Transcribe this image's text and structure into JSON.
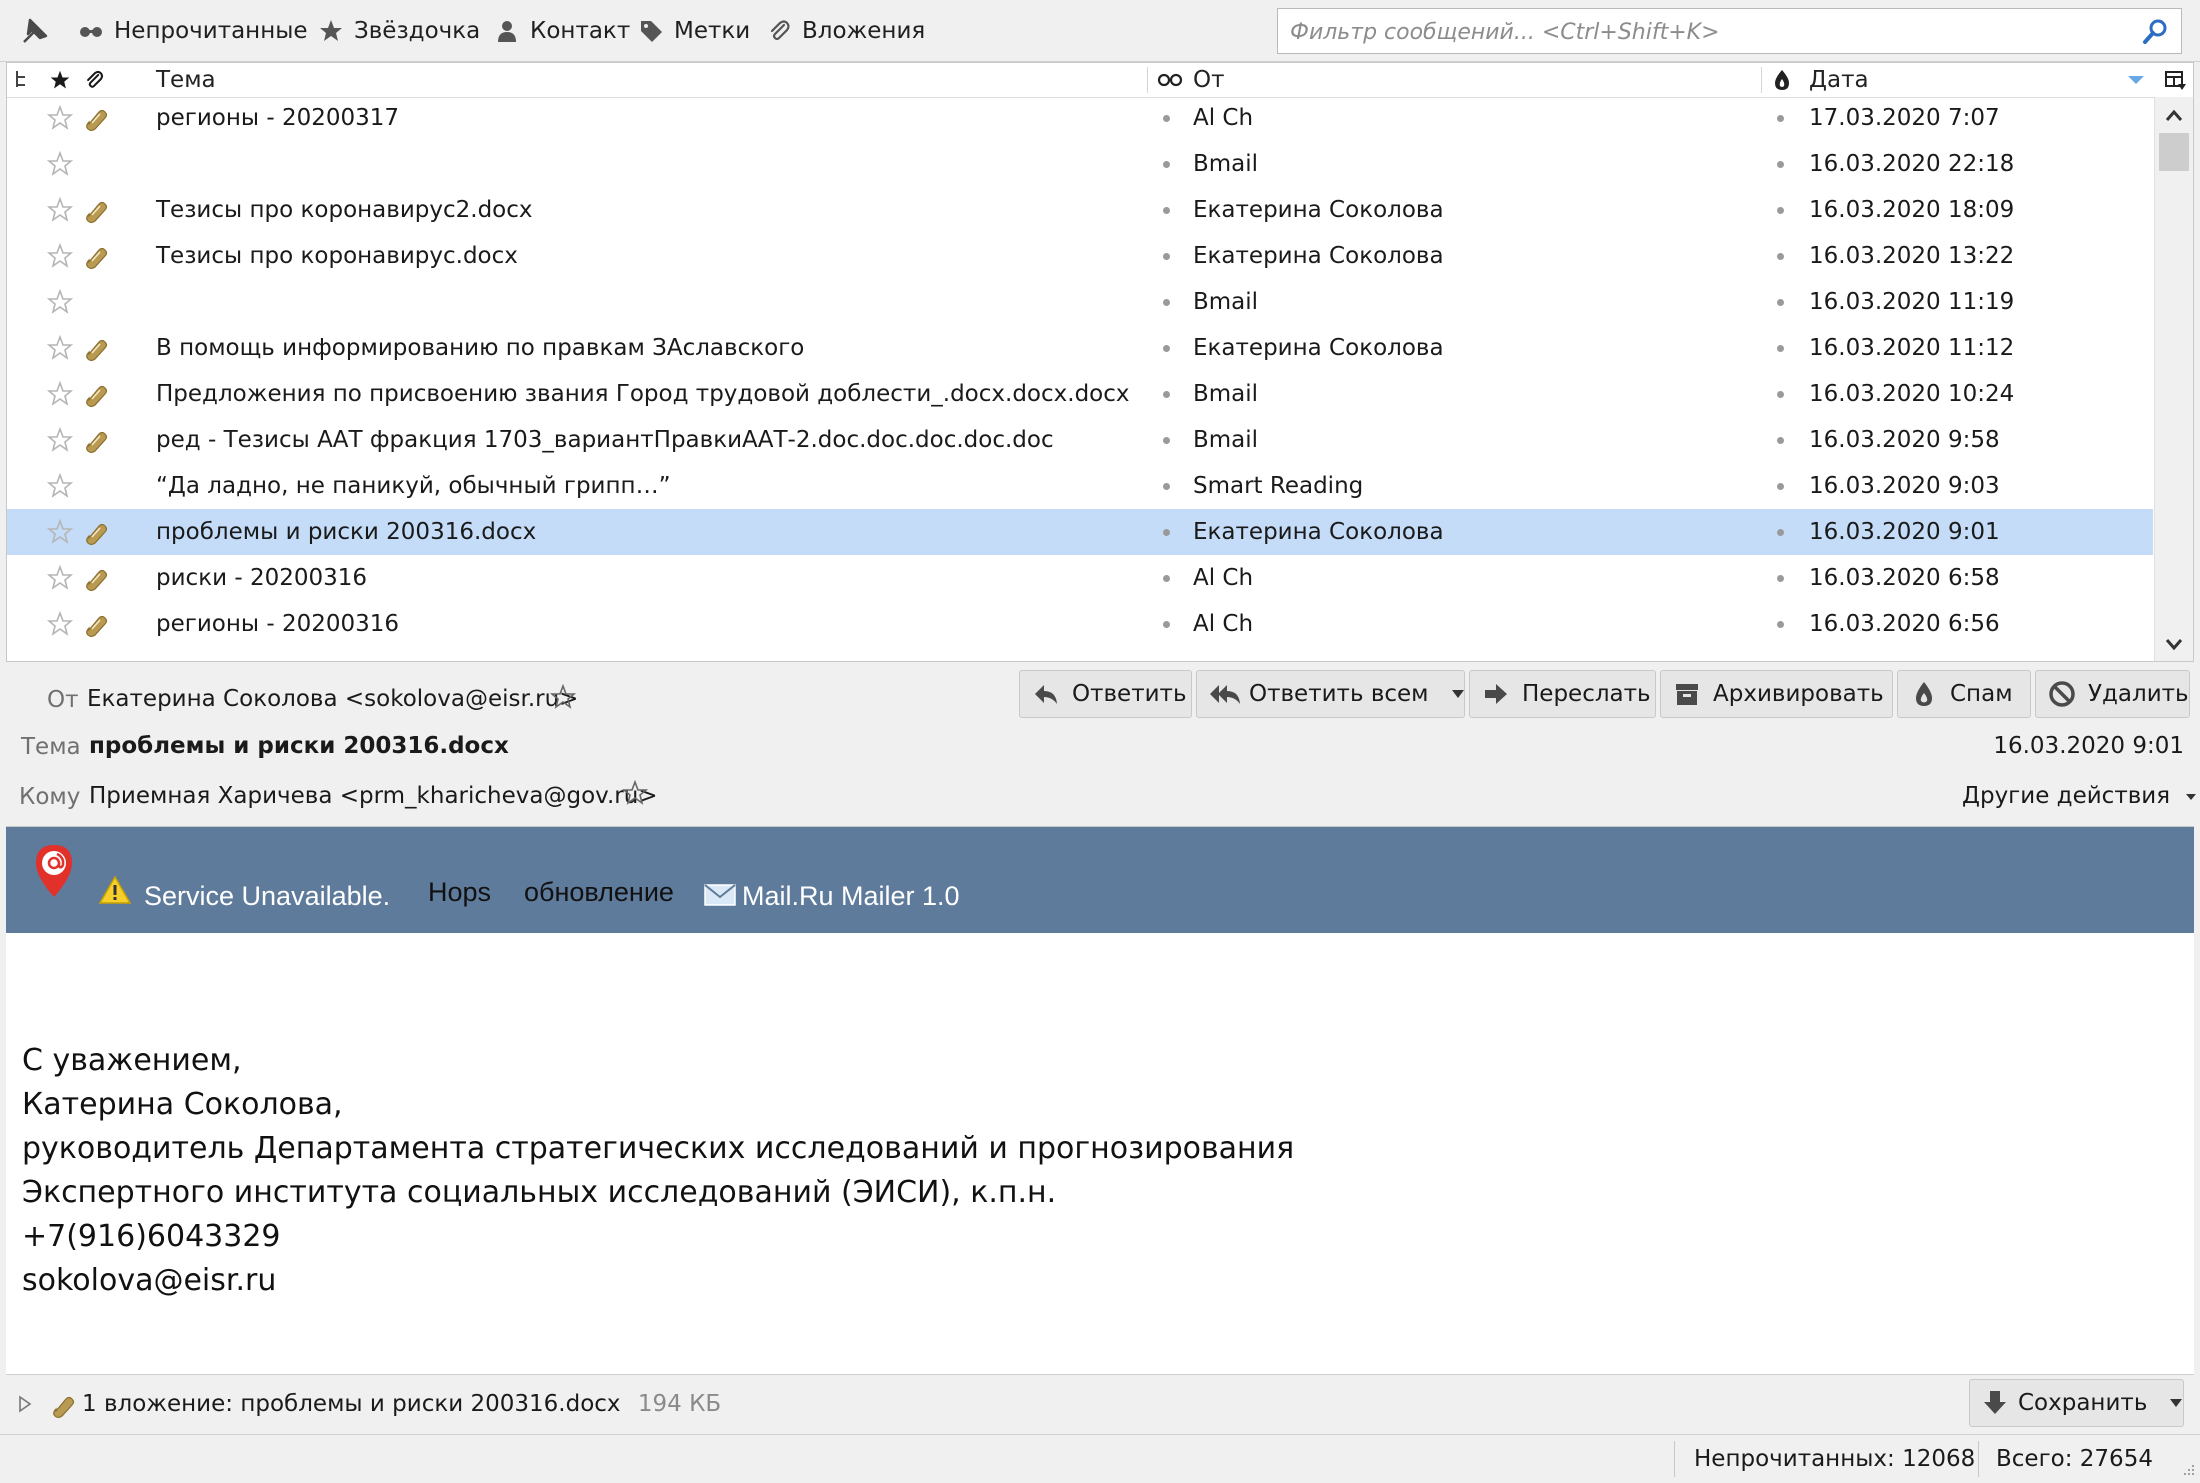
{
  "quick_filter": {
    "unread": "Непрочитанные",
    "starred": "Звёздочка",
    "contact": "Контакт",
    "tags": "Метки",
    "attachments": "Вложения",
    "search_placeholder": "Фильтр сообщений... <Ctrl+Shift+K>"
  },
  "columns": {
    "subject": "Тема",
    "from": "От",
    "date": "Дата"
  },
  "messages": [
    {
      "subject": "регионы - 20200317",
      "from": "Al Ch",
      "date": "17.03.2020 7:07",
      "attachment": true
    },
    {
      "subject": "",
      "from": "Bmail",
      "date": "16.03.2020 22:18",
      "attachment": false
    },
    {
      "subject": "Тезисы про коронавирус2.docx",
      "from": "Екатерина Соколова",
      "date": "16.03.2020 18:09",
      "attachment": true
    },
    {
      "subject": "Тезисы про коронавирус.docx",
      "from": "Екатерина Соколова",
      "date": "16.03.2020 13:22",
      "attachment": true
    },
    {
      "subject": "",
      "from": "Bmail",
      "date": "16.03.2020 11:19",
      "attachment": false
    },
    {
      "subject": "В помощь информированию по правкам ЗАславского",
      "from": "Екатерина Соколова",
      "date": "16.03.2020 11:12",
      "attachment": true
    },
    {
      "subject": "Предложения по присвоению звания Город трудовой доблести_.docx.docx.docx",
      "from": "Bmail",
      "date": "16.03.2020 10:24",
      "attachment": true
    },
    {
      "subject": "ред - Тезисы ААТ фракция 1703_вариантПравкиААТ-2.doc.doc.doc.doc.doc",
      "from": "Bmail",
      "date": "16.03.2020 9:58",
      "attachment": true
    },
    {
      "subject": "“Да ладно, не паникуй, обычный грипп…”",
      "from": "Smart Reading",
      "date": "16.03.2020 9:03",
      "attachment": false
    },
    {
      "subject": "проблемы и риски 200316.docx",
      "from": "Екатерина Соколова",
      "date": "16.03.2020 9:01",
      "attachment": true,
      "selected": true
    },
    {
      "subject": "риски - 20200316",
      "from": "Al Ch",
      "date": "16.03.2020 6:58",
      "attachment": true
    },
    {
      "subject": "регионы - 20200316",
      "from": "Al Ch",
      "date": "16.03.2020 6:56",
      "attachment": true
    }
  ],
  "message_header": {
    "from_label": "От",
    "from_value": "Екатерина Соколова <sokolova@eisr.ru>",
    "subject_label": "Тема",
    "subject_value": "проблемы и риски 200316.docx",
    "date": "16.03.2020 9:01",
    "to_label": "Кому",
    "to_value": "Приемная Харичева <prm_kharicheva@gov.ru>",
    "other_actions": "Другие действия"
  },
  "toolbar": {
    "reply": "Ответить",
    "reply_all": "Ответить всем",
    "forward": "Переслать",
    "archive": "Архивировать",
    "spam": "Спам",
    "delete": "Удалить"
  },
  "banner": {
    "service_unavailable": "Service Unavailable.",
    "hops": "Hops",
    "update": "обновление",
    "mailer": "Mail.Ru Mailer 1.0",
    "background": "#5f7b9c"
  },
  "signature": {
    "line1": "С уважением,",
    "line2": "Катерина Соколова,",
    "line3": "руководитель Департамента стратегических исследований и прогнозирования",
    "line4": "Экспертного института социальных исследований (ЭИСИ), к.п.н.",
    "line5": "+7(916)6043329",
    "line6": "sokolova@eisr.ru"
  },
  "attachment_bar": {
    "text": "1 вложение: проблемы и риски 200316.docx",
    "size": "194 КБ",
    "save": "Сохранить"
  },
  "status": {
    "unread": "Непрочитанных: 12068",
    "total": "Всего: 27654"
  },
  "colors": {
    "selected_row": "#c4dcf8",
    "clip": "#b89a52",
    "banner": "#5f7b9c"
  }
}
